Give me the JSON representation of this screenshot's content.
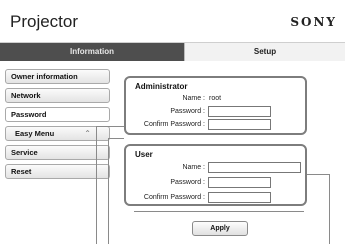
{
  "header": {
    "title": "Projector",
    "brand": "SONY"
  },
  "tabs": [
    {
      "label": "Information",
      "active": false
    },
    {
      "label": "Setup",
      "active": true
    }
  ],
  "sidebar": {
    "items": [
      {
        "label": "Owner information"
      },
      {
        "label": "Network"
      },
      {
        "label": "Password",
        "active": true
      },
      {
        "label": "Easy Menu",
        "expandable": true
      },
      {
        "label": "Service"
      },
      {
        "label": "Reset"
      }
    ]
  },
  "administrator": {
    "title": "Administrator",
    "name_label": "Name :",
    "name_value": "root",
    "password_label": "Password :",
    "password_value": "",
    "confirm_label": "Confirm Password :",
    "confirm_value": ""
  },
  "user": {
    "title": "User",
    "name_label": "Name :",
    "name_value": "",
    "password_label": "Password :",
    "password_value": "",
    "confirm_label": "Confirm Password :",
    "confirm_value": ""
  },
  "apply_label": "Apply",
  "colors": {
    "tab_inactive": "#4e4e4e",
    "tab_active": "#f2f2f2",
    "border": "#7d7d7d"
  },
  "icons": {
    "expand": "chevron-up-icon"
  }
}
